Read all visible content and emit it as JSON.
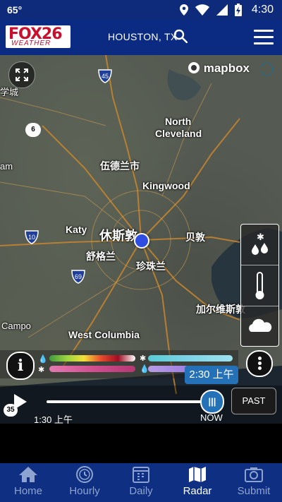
{
  "status_bar": {
    "temperature": "65°",
    "time": "4:30"
  },
  "header": {
    "logo_text": "FOX26",
    "logo_sub": "WEATHER",
    "location": "HOUSTON, TX"
  },
  "map": {
    "attribution": "mapbox",
    "labels": {
      "xuechengbao": "学城",
      "north_cleveland_1": "North",
      "north_cleveland_2": "Cleveland",
      "wudelan": "伍德兰市",
      "kingwood": "Kingwood",
      "am": "am",
      "katy": "Katy",
      "houston": "休斯敦",
      "beidun": "贝敦",
      "shugelan": "舒格兰",
      "zhenzhulan": "珍珠兰",
      "jiaerweisidun": "加尔维斯敦",
      "campo": "Campo",
      "west_columbia": "West Columbia"
    },
    "highways": {
      "i45": "45",
      "r6": "6",
      "i10": "10",
      "i69": "69",
      "r35": "35"
    }
  },
  "timeline": {
    "current_time_bubble": "2:30 上午",
    "start_time": "1:30 上午",
    "end_label": "NOW",
    "past_button": "PAST",
    "progress": 1.0
  },
  "bottom_nav": {
    "items": [
      {
        "label": "Home",
        "icon": "home-icon",
        "active": false
      },
      {
        "label": "Hourly",
        "icon": "clock-icon",
        "active": false
      },
      {
        "label": "Daily",
        "icon": "calendar-icon",
        "active": false
      },
      {
        "label": "Radar",
        "icon": "map-icon",
        "active": true
      },
      {
        "label": "Submit",
        "icon": "camera-icon",
        "active": false
      }
    ]
  },
  "colors": {
    "header_bg": "#0b2a82",
    "nav_bg": "#0e2f82",
    "accent": "#2571b8",
    "inactive_nav": "#8ea3cf"
  }
}
